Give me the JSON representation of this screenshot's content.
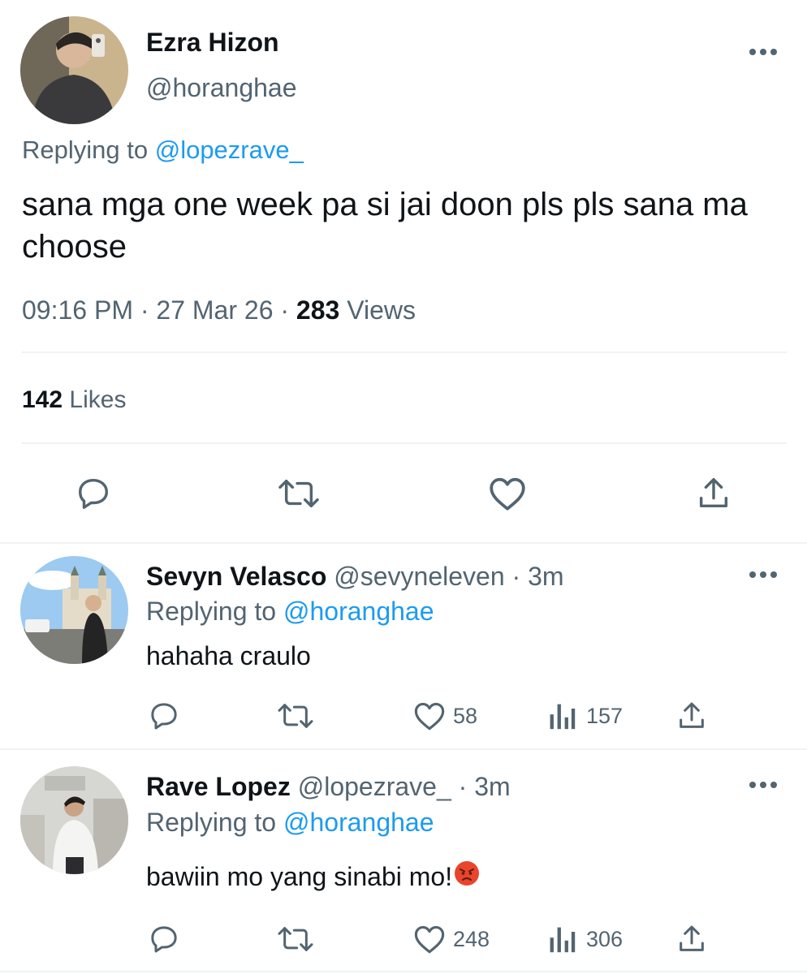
{
  "main_tweet": {
    "display_name": "Ezra Hizon",
    "handle": "@horanghae",
    "replying_to_prefix": "Replying to",
    "replying_to_handle": "@lopezrave_",
    "text": "sana mga one week pa si jai doon pls pls sana ma choose",
    "time": "09:16 PM",
    "date": "27 Mar 26",
    "views_count": "283",
    "views_label": "Views",
    "likes_count": "142",
    "likes_label": "Likes"
  },
  "replies": [
    {
      "display_name": "Sevyn Velasco",
      "handle": "@sevyneleven",
      "age": "3m",
      "replying_to_prefix": "Replying to",
      "replying_to_handle": "@horanghae",
      "text": "hahaha craulo",
      "likes": "58",
      "views": "157"
    },
    {
      "display_name": "Rave Lopez",
      "handle": "@lopezrave_",
      "age": "3m",
      "replying_to_prefix": "Replying to",
      "replying_to_handle": "@horanghae",
      "text": "bawiin mo yang sinabi mo!",
      "emoji": "😡",
      "likes": "248",
      "views": "306"
    }
  ],
  "separators": {
    "dot": "·"
  },
  "colors": {
    "accent": "#1d9bf0",
    "secondary_text": "#536471",
    "divider": "#eff3f4",
    "angry_emoji": "#e8452c"
  },
  "icons": [
    "reply-icon",
    "retweet-icon",
    "like-icon",
    "views-icon",
    "share-icon",
    "more-icon"
  ]
}
